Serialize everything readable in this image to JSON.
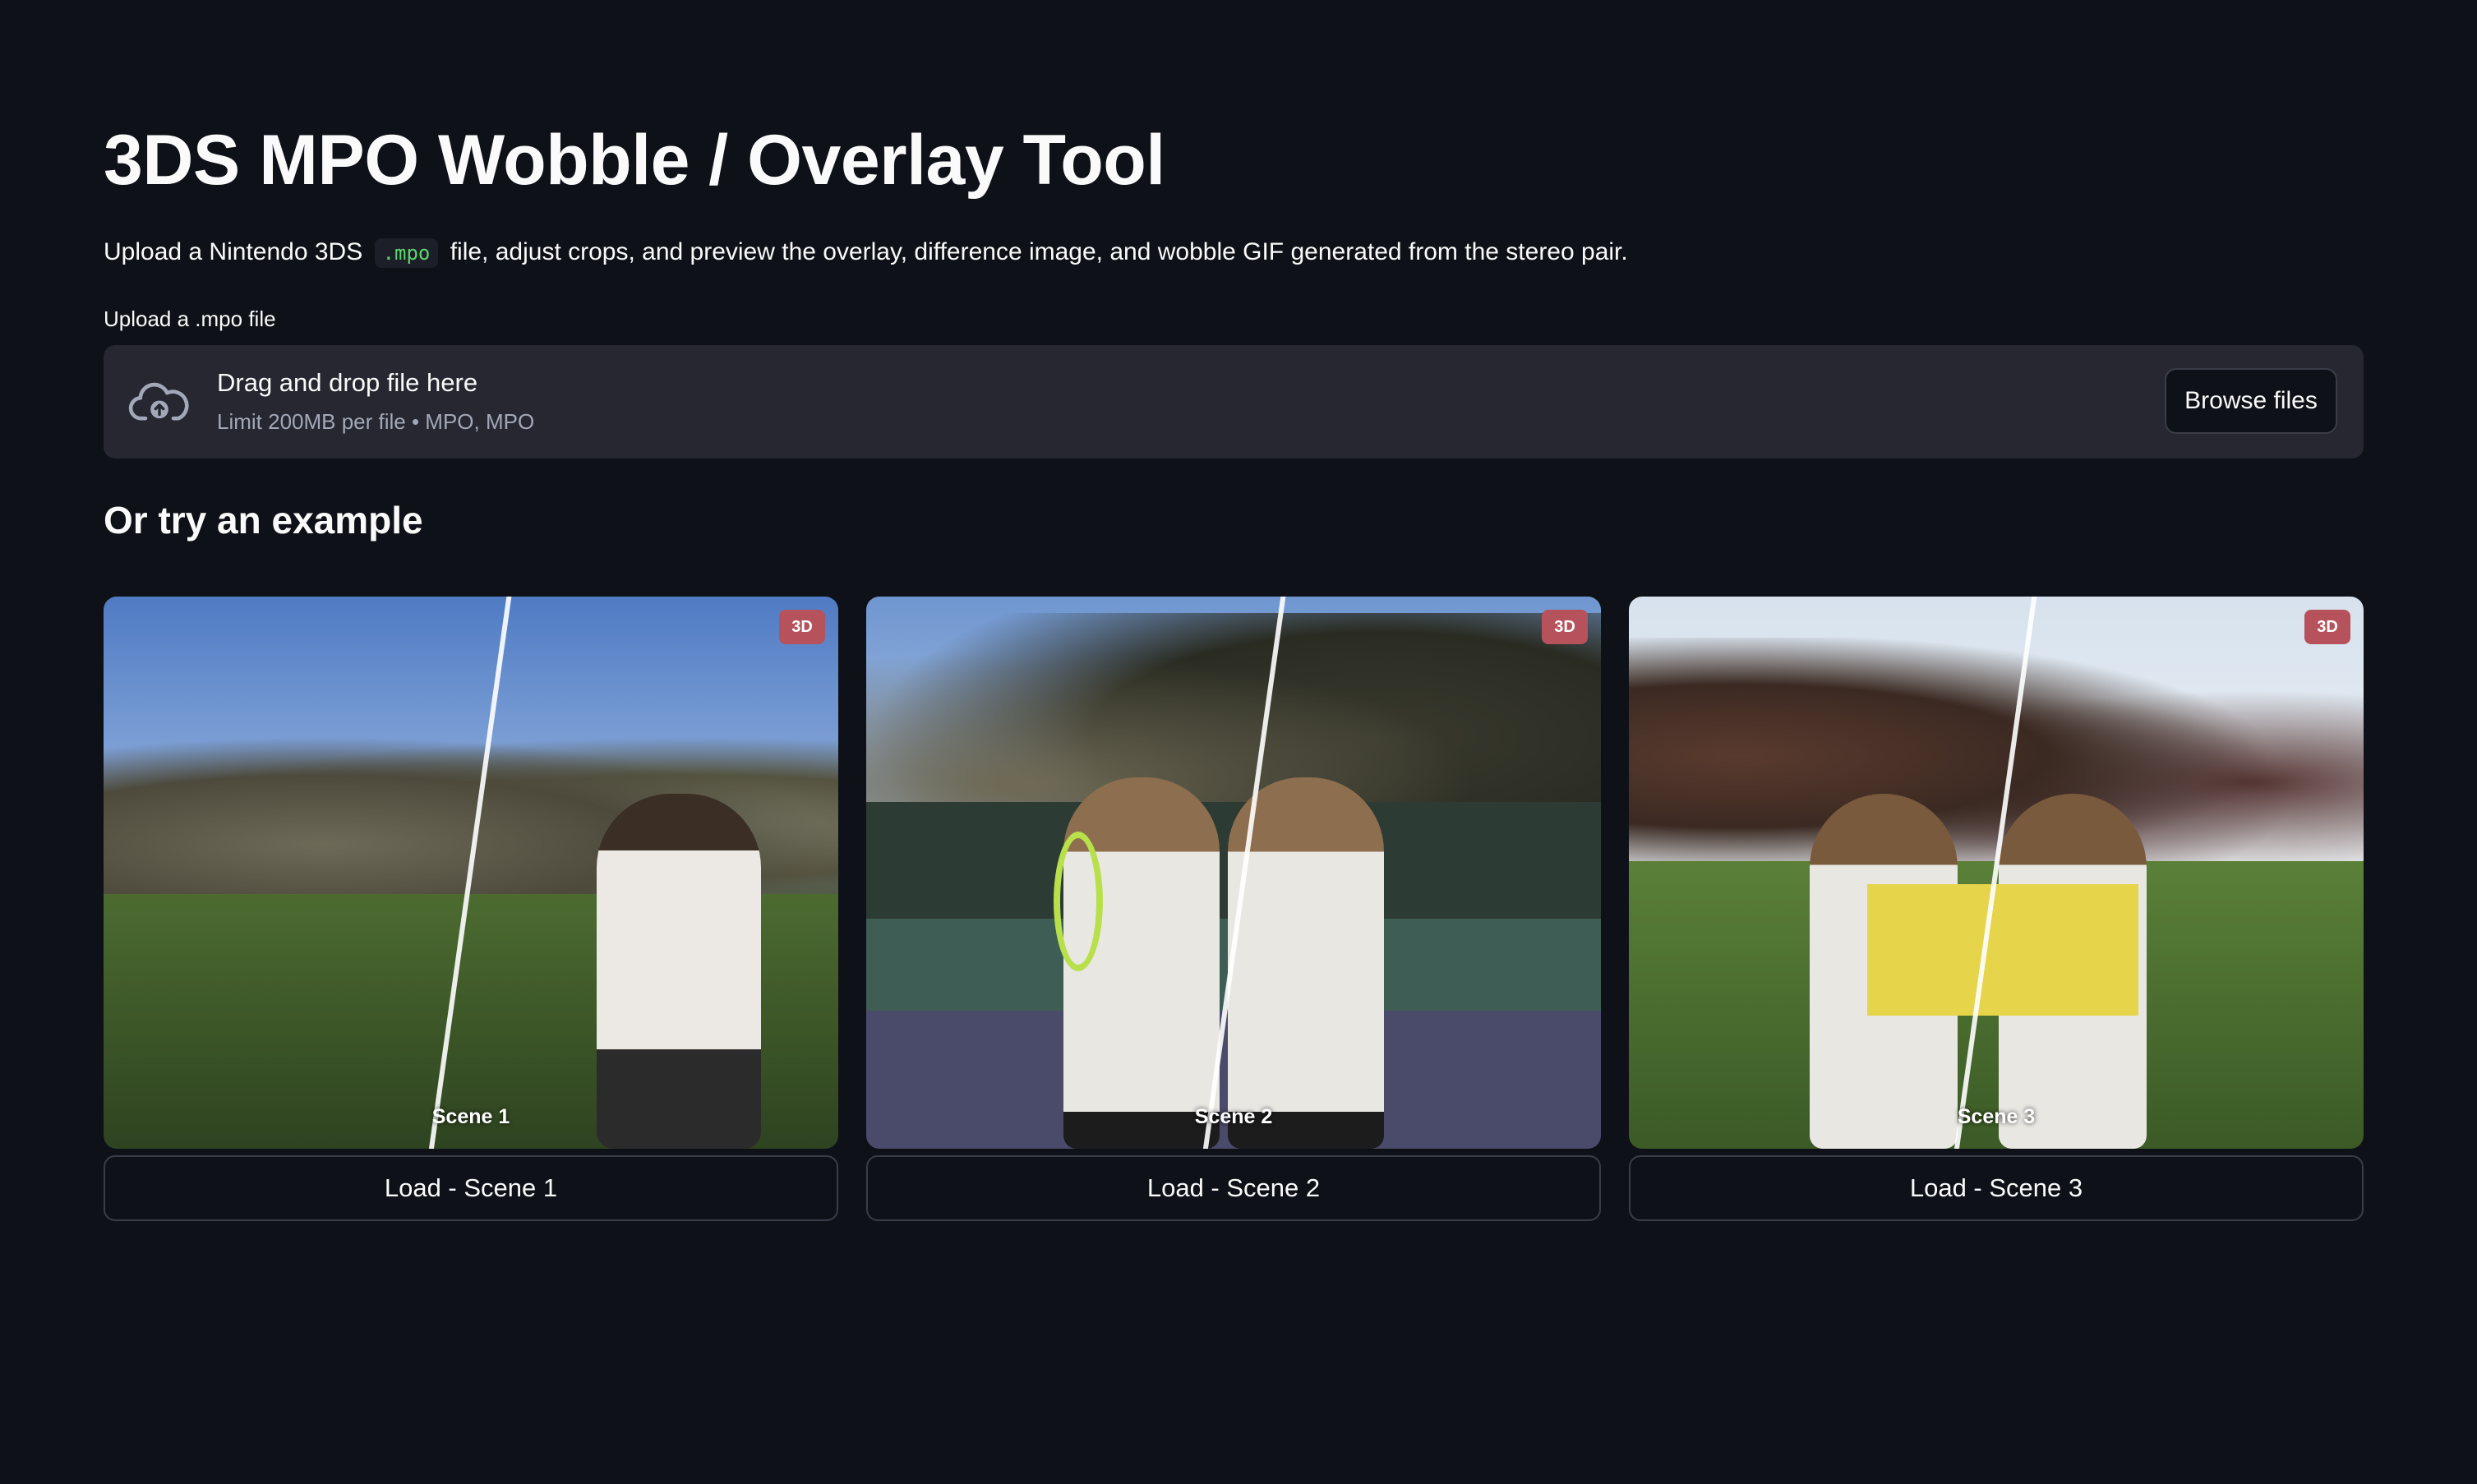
{
  "page": {
    "title": "3DS MPO Wobble / Overlay Tool",
    "intro_before": "Upload a Nintendo 3DS",
    "intro_code": ".mpo",
    "intro_after": "file, adjust crops, and preview the overlay, difference image, and wobble GIF generated from the stereo pair."
  },
  "uploader": {
    "label": "Upload a .mpo file",
    "drag_text": "Drag and drop file here",
    "limit_text": "Limit 200MB per file • MPO, MPO",
    "browse_label": "Browse files",
    "icon": "cloud-upload-icon"
  },
  "examples": {
    "heading": "Or try an example",
    "badge": "3D",
    "items": [
      {
        "caption": "Scene 1",
        "button": "Load - Scene 1"
      },
      {
        "caption": "Scene 2",
        "button": "Load - Scene 2"
      },
      {
        "caption": "Scene 3",
        "button": "Load - Scene 3"
      }
    ]
  },
  "colors": {
    "background": "#0e1117",
    "surface": "#262730",
    "badge": "#b5525c",
    "code_text": "#5ed66e"
  }
}
